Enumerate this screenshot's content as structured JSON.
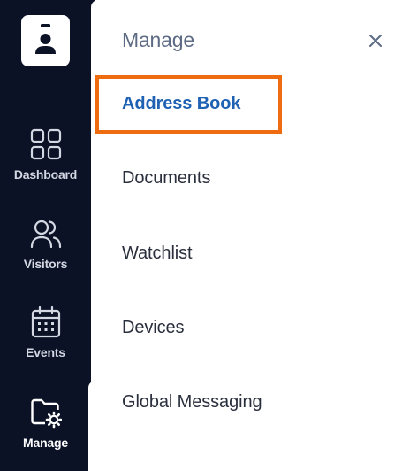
{
  "sidebar": {
    "items": [
      {
        "id": "dashboard",
        "label": "Dashboard",
        "icon": "grid-icon"
      },
      {
        "id": "visitors",
        "label": "Visitors",
        "icon": "users-icon"
      },
      {
        "id": "events",
        "label": "Events",
        "icon": "calendar-icon"
      },
      {
        "id": "manage",
        "label": "Manage",
        "icon": "folder-gear-icon",
        "active": true
      }
    ],
    "logo_icon": "badge-icon"
  },
  "panel": {
    "title": "Manage",
    "close_icon": "close-icon",
    "items": [
      {
        "label": "Address Book",
        "active": true
      },
      {
        "label": "Documents"
      },
      {
        "label": "Watchlist"
      },
      {
        "label": "Devices"
      },
      {
        "label": "Global Messaging"
      }
    ]
  },
  "colors": {
    "sidebar_bg": "#0b1226",
    "accent_blue": "#1f62b3",
    "highlight_orange": "#ee6b10",
    "title_gray": "#5d6b84"
  }
}
